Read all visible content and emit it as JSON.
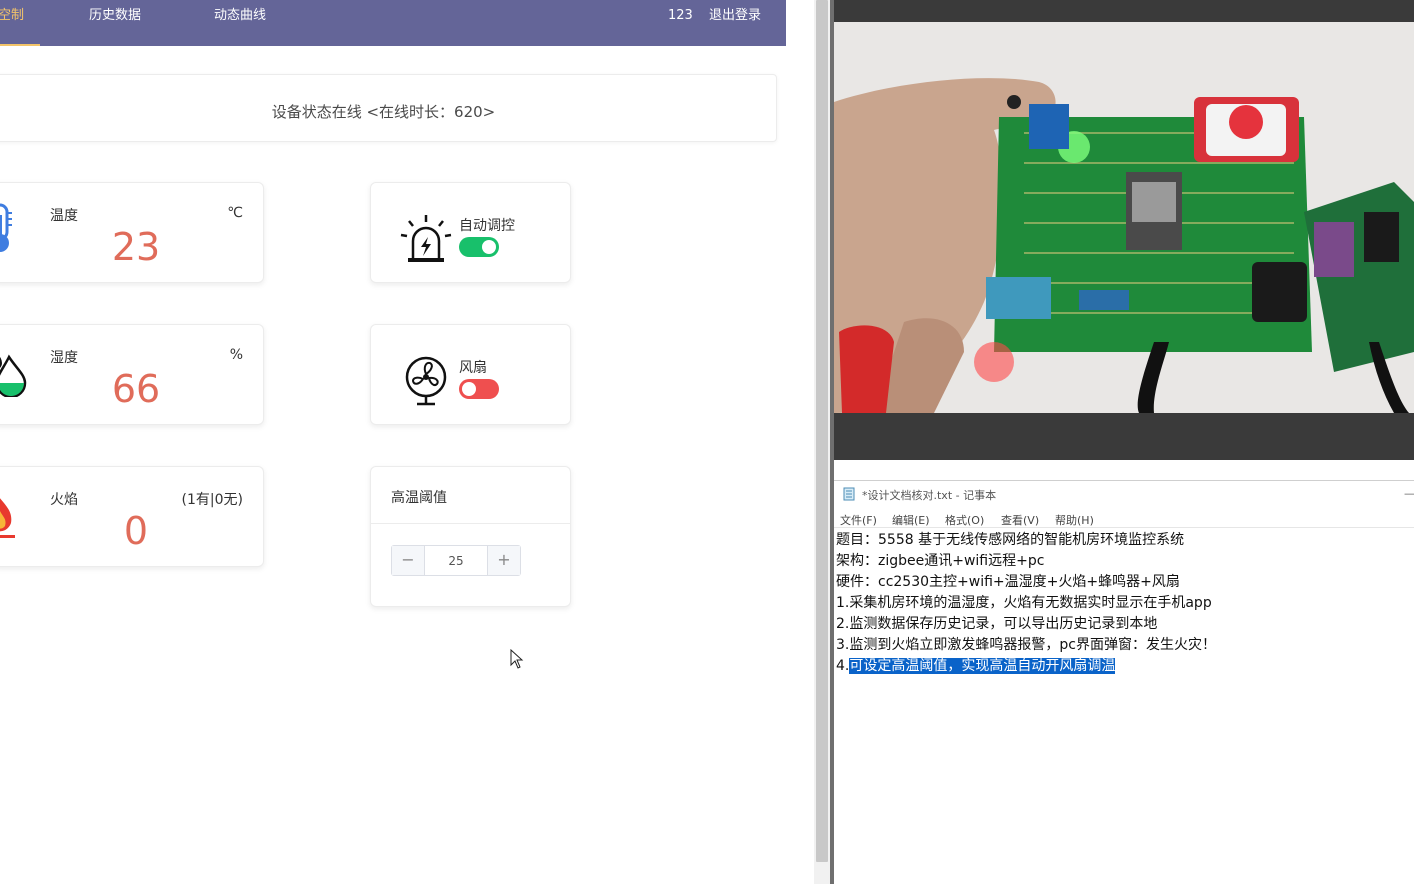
{
  "nav": {
    "active_tab": "控制",
    "active_tab_visible": "空制",
    "tabs": [
      "历史数据",
      "动态曲线"
    ],
    "user": "123",
    "logout": "退出登录"
  },
  "status": {
    "text": "设备状态在线 <在线时长：620>"
  },
  "sensors": [
    {
      "label": "温度",
      "unit": "℃",
      "value": "23",
      "icon": "thermometer-icon"
    },
    {
      "label": "湿度",
      "unit": "%",
      "value": "66",
      "icon": "water-drop-icon"
    },
    {
      "label": "火焰",
      "unit": "(1有|0无)",
      "value": "0",
      "icon": "flame-icon"
    }
  ],
  "controls": {
    "auto": {
      "label": "自动调控",
      "state": "on",
      "icon": "alarm-icon"
    },
    "fan": {
      "label": "风扇",
      "state": "off",
      "icon": "fan-icon"
    }
  },
  "threshold": {
    "title": "高温阈值",
    "value": "25",
    "minus": "−",
    "plus": "+"
  },
  "notepad": {
    "title": "*设计文档核对.txt - 记事本",
    "minimize": "—",
    "menu": [
      "文件(F)",
      "编辑(E)",
      "格式(O)",
      "查看(V)",
      "帮助(H)"
    ],
    "lines": [
      "题目：5558  基于无线传感网络的智能机房环境监控系统",
      "架构：zigbee通讯+wifi远程+pc",
      "硬件：cc2530主控+wifi+温湿度+火焰+蜂鸣器+风扇",
      "1.采集机房环境的温湿度，火焰有无数据实时显示在手机app",
      "2.监测数据保存历史记录，可以导出历史记录到本地",
      "3.监测到火焰立即激发蜂鸣器报警，pc界面弹窗：发生火灾！"
    ],
    "last_line_prefix": "4.",
    "last_line_selected": "可设定高温阈值，实现高温自动开风扇调温"
  },
  "colors": {
    "nav_bg": "#646598",
    "nav_active": "#f3c46a",
    "value_red": "#e06c5a",
    "switch_on": "#18c06b",
    "switch_off": "#ef4f4f",
    "selection": "#0a63c9"
  }
}
